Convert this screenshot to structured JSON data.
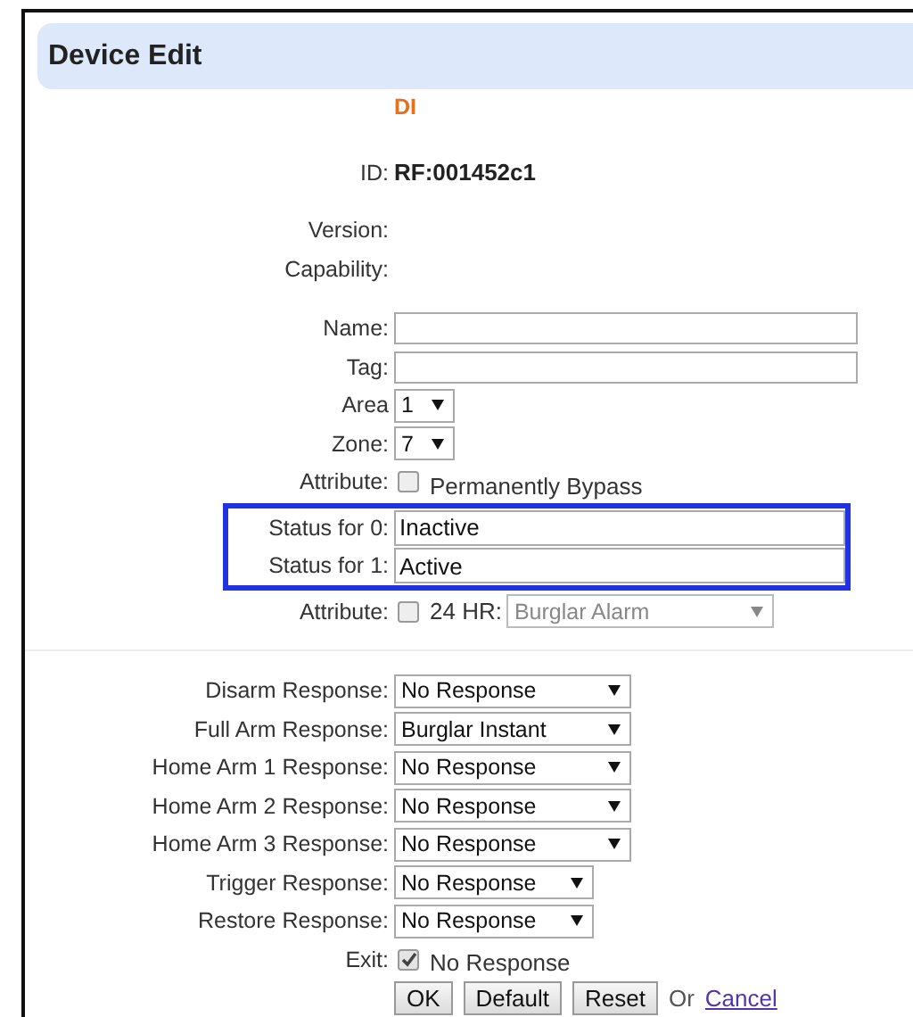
{
  "header": {
    "title": "Device Edit"
  },
  "device_type": "DI",
  "id": {
    "label": "ID:",
    "value": "RF:001452c1"
  },
  "info": [
    {
      "label": "Version:"
    },
    {
      "label": "Capability:"
    }
  ],
  "groups": [
    {
      "highlighted": false,
      "fields": [
        {
          "kind": "text",
          "label": "Name:"
        },
        {
          "kind": "text",
          "label": "Tag:"
        },
        {
          "kind": "select",
          "label": "Area",
          "value": "1"
        },
        {
          "kind": "select",
          "label": "Zone:",
          "value": "7"
        },
        {
          "kind": "checkbox",
          "label": "Attribute:",
          "checked": false,
          "text": "Permanently Bypass"
        }
      ]
    },
    {
      "highlighted": true,
      "fields": [
        {
          "kind": "text",
          "label": "Status for 0:",
          "value": "Inactive"
        },
        {
          "kind": "text",
          "label": "Status for 1:",
          "value": "Active"
        }
      ]
    },
    {
      "highlighted": false,
      "fields": [
        {
          "kind": "checkbox_select",
          "label": "Attribute:",
          "checked": false,
          "text": "24 HR:",
          "value": "Burglar Alarm",
          "disabled": true
        }
      ]
    }
  ],
  "responses": [
    {
      "label": "Disarm Response:",
      "value": "No Response"
    },
    {
      "label": "Full Arm Response:",
      "value": "Burglar Instant"
    },
    {
      "label": "Home Arm 1 Response:",
      "value": "No Response"
    },
    {
      "label": "Home Arm 2 Response:",
      "value": "No Response"
    },
    {
      "label": "Home Arm 3 Response:",
      "value": "No Response"
    },
    {
      "label": "Trigger Response:",
      "value": "No Response"
    },
    {
      "label": "Restore Response:",
      "value": "No Response"
    }
  ],
  "exit": {
    "label": "Exit:",
    "checked": true,
    "text": "No Response"
  },
  "buttons": [
    "OK",
    "Default",
    "Reset"
  ],
  "or_text": "Or",
  "cancel_link": "Cancel"
}
